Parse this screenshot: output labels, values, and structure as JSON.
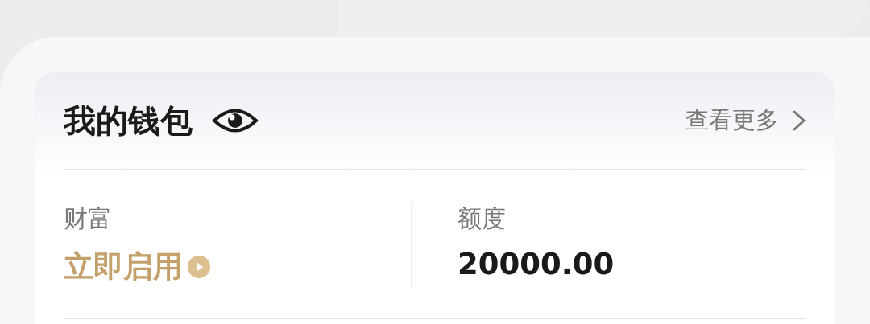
{
  "wallet": {
    "title": "我的钱包",
    "more_link": "查看更多",
    "columns": [
      {
        "label": "财富",
        "value": "立即启用",
        "kind": "action"
      },
      {
        "label": "额度",
        "value": "20000.00",
        "kind": "amount"
      }
    ]
  }
}
